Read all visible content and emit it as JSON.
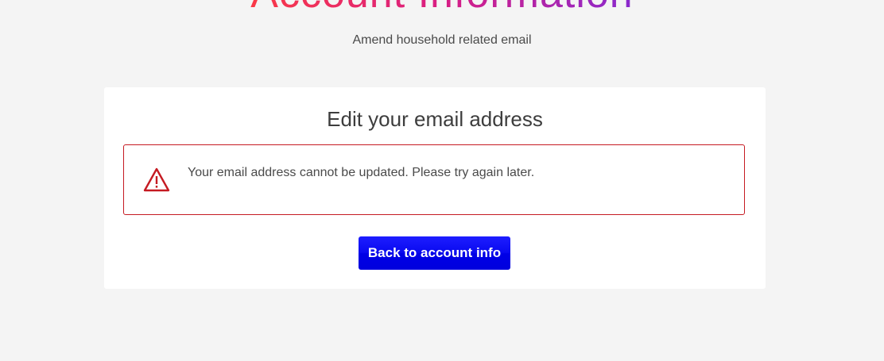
{
  "header": {
    "title": "Account Information",
    "subtitle": "Amend household related email"
  },
  "card": {
    "title": "Edit your email address",
    "error": {
      "icon": "warning-icon",
      "message": "Your email address cannot be updated. Please try again later.",
      "color": "#c51a22"
    },
    "back_button_label": "Back to account info",
    "back_button_color": "#0000e6"
  }
}
